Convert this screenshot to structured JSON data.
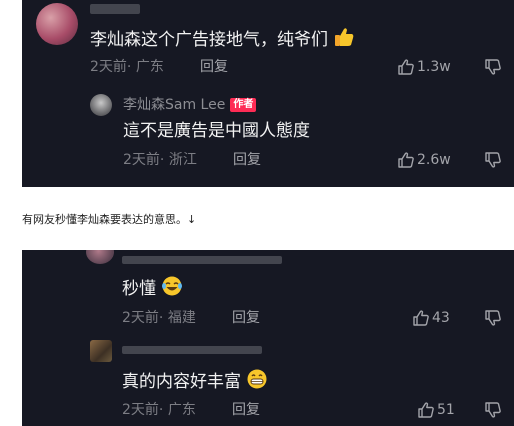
{
  "comments": [
    {
      "text": "李灿森这个广告接地气，纯爷们",
      "emoji": "thumbs-up-emoji",
      "time": "2天前",
      "location": "· 广东",
      "reply_label": "回复",
      "likes": "1.3w"
    },
    {
      "author": "李灿森Sam Lee",
      "author_tag": "作者",
      "text": "這不是廣告是中國人態度",
      "time": "2天前",
      "location": "· 浙江",
      "reply_label": "回复",
      "likes": "2.6w"
    }
  ],
  "caption": "有网友秒懂李灿森要表达的意思。↓",
  "comments_bottom": [
    {
      "text": "秒懂",
      "emoji": "laughing-tears-emoji",
      "time": "2天前",
      "location": "· 福建",
      "reply_label": "回复",
      "likes": "43"
    },
    {
      "text": "真的内容好丰富",
      "emoji": "grinning-emoji",
      "time": "2天前",
      "location": "· 广东",
      "reply_label": "回复",
      "likes": "51"
    }
  ],
  "colors": {
    "panel_bg": "#161823",
    "author_tag": "#fe2c55",
    "emoji_yellow": "#f7c62b"
  }
}
